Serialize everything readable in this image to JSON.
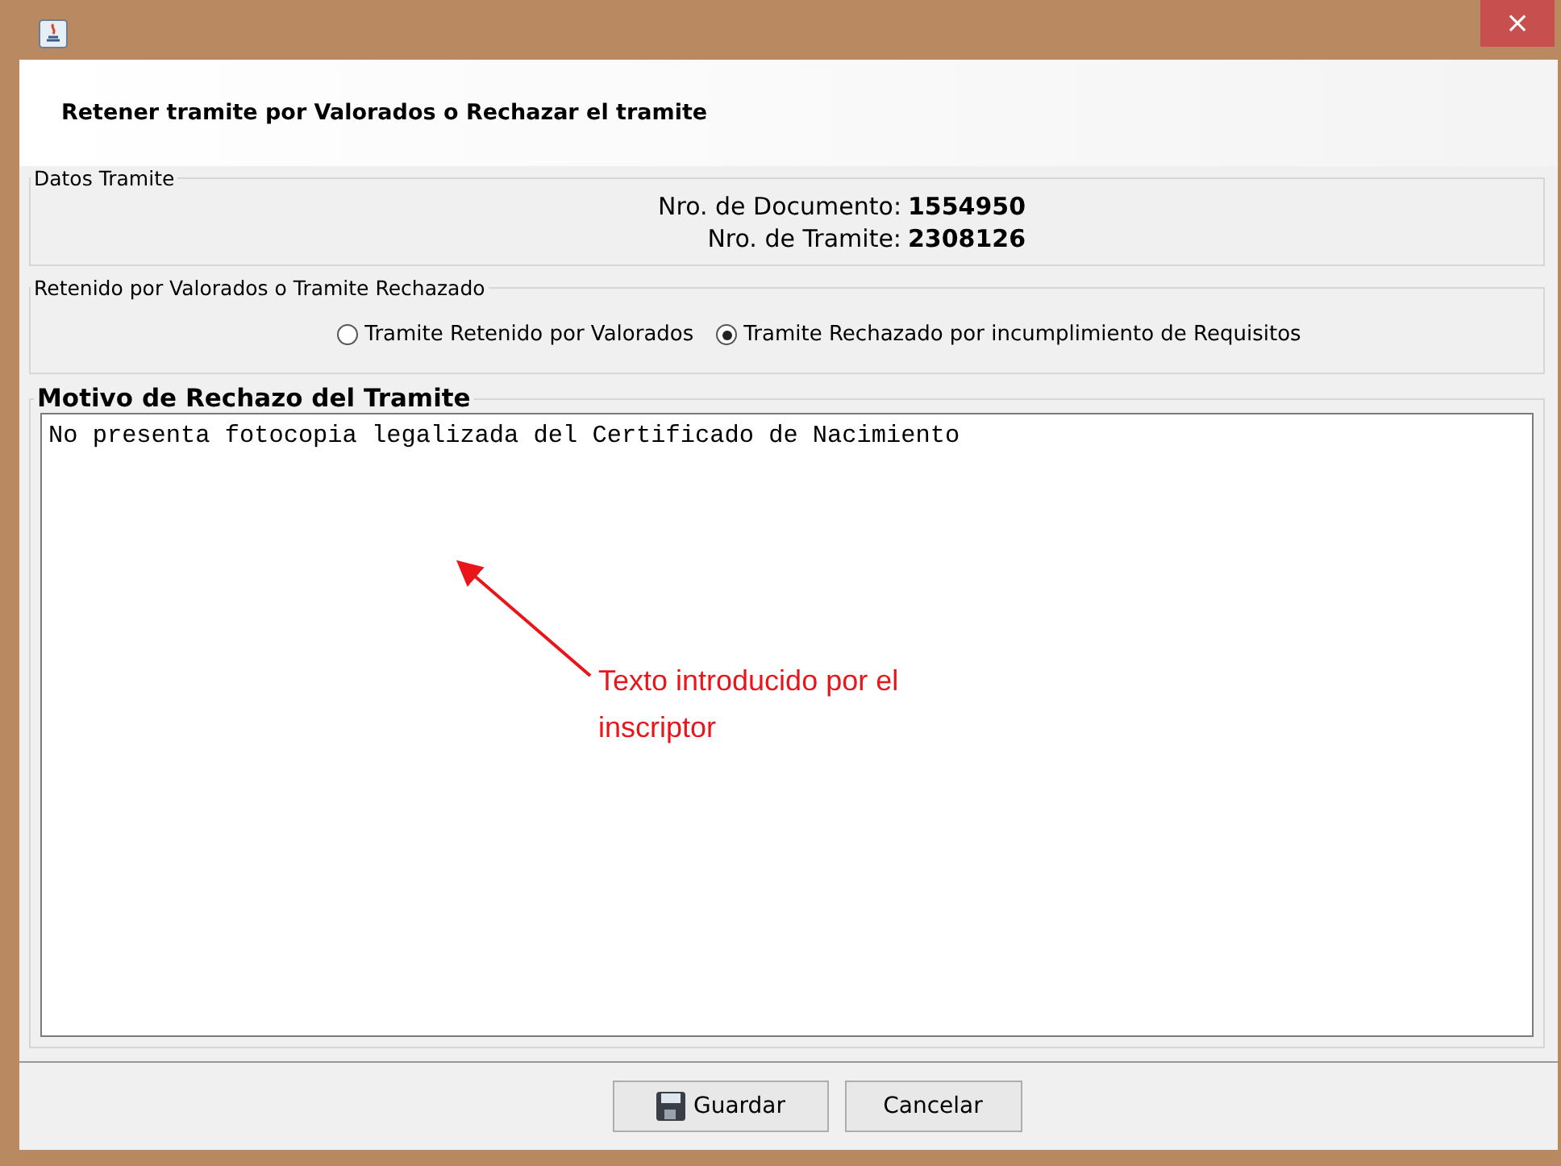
{
  "window": {
    "close": "×"
  },
  "header": {
    "title": "Retener tramite por Valorados o Rechazar el tramite"
  },
  "datos": {
    "legend": "Datos Tramite",
    "fields": [
      {
        "label": "Nro. de Documento:",
        "value": "1554950"
      },
      {
        "label": "Nro. de Tramite:",
        "value": "2308126"
      }
    ]
  },
  "retencion": {
    "legend": "Retenido por Valorados o Tramite Rechazado",
    "options": [
      {
        "label": "Tramite Retenido por Valorados",
        "selected": false
      },
      {
        "label": "Tramite Rechazado por incumplimiento de Requisitos",
        "selected": true
      }
    ]
  },
  "motivo": {
    "legend": "Motivo de Rechazo del Tramite",
    "value": "No presenta fotocopia legalizada del Certificado de Nacimiento"
  },
  "annotation": {
    "text": "Texto introducido por el inscriptor"
  },
  "buttons": [
    {
      "kind": "save",
      "label": "Guardar"
    },
    {
      "kind": "plain",
      "label": "Cancelar"
    }
  ]
}
